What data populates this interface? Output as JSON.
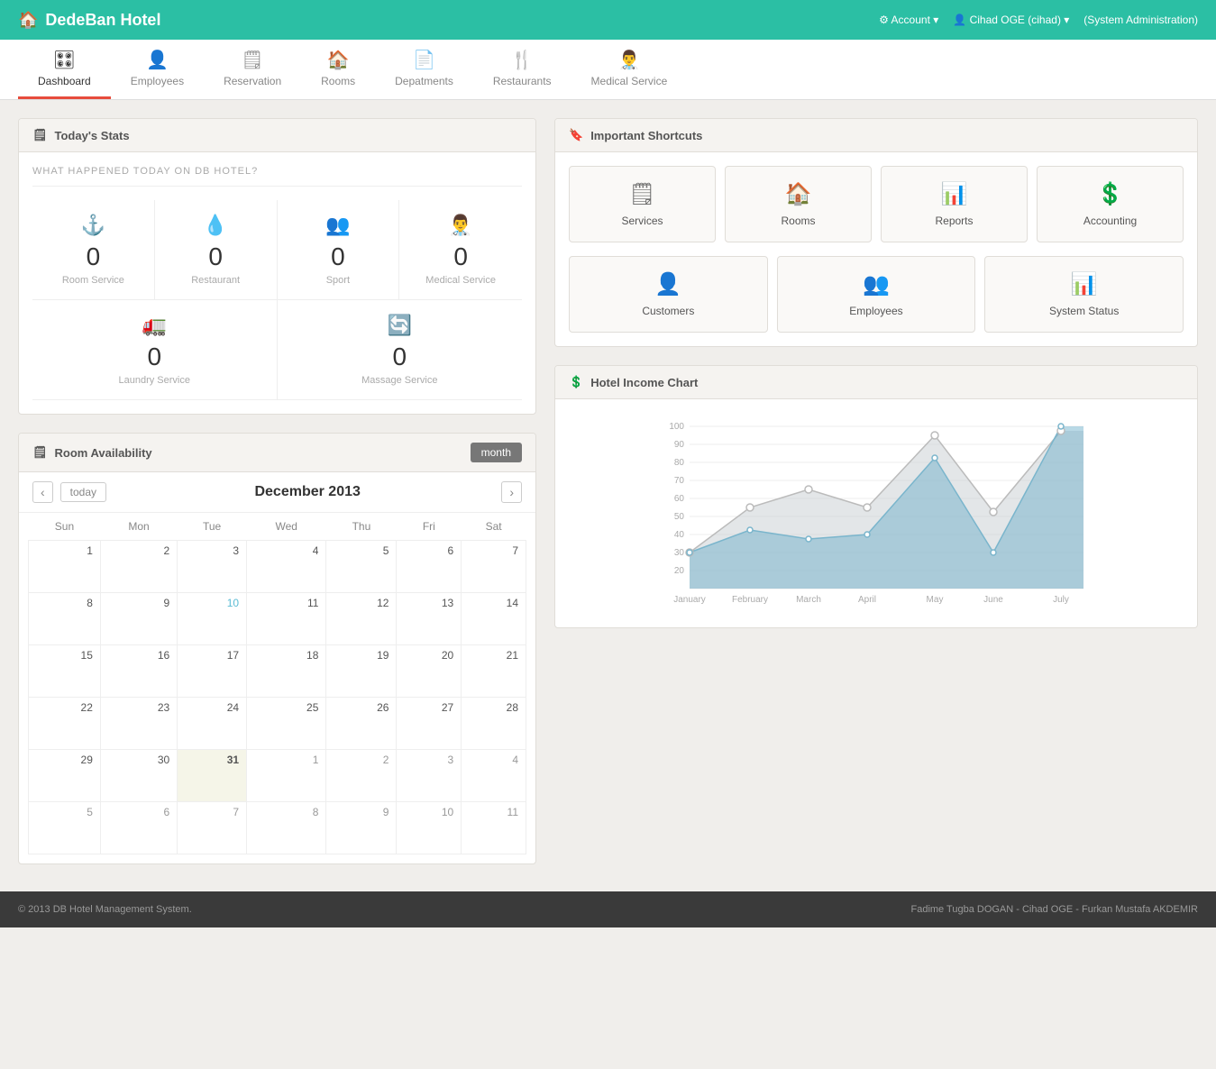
{
  "header": {
    "brand": "DedeBan Hotel",
    "home_icon": "🏠",
    "account_label": "Account",
    "user_label": "Cihad OGE (cihad)",
    "role_label": "(System Administration)"
  },
  "nav": {
    "items": [
      {
        "id": "dashboard",
        "label": "Dashboard",
        "icon": "🎛",
        "active": true
      },
      {
        "id": "employees",
        "label": "Employees",
        "icon": "👤",
        "active": false
      },
      {
        "id": "reservation",
        "label": "Reservation",
        "icon": "🗒",
        "active": false
      },
      {
        "id": "rooms",
        "label": "Rooms",
        "icon": "🏠",
        "active": false
      },
      {
        "id": "departments",
        "label": "Depatments",
        "icon": "📄",
        "active": false
      },
      {
        "id": "restaurants",
        "label": "Restaurants",
        "icon": "🍴",
        "active": false
      },
      {
        "id": "medical",
        "label": "Medical Service",
        "icon": "👨‍⚕️",
        "active": false
      }
    ]
  },
  "stats": {
    "title": "Today's Stats",
    "subtitle": "WHAT HAPPENED TODAY ON DB HOTEL?",
    "items": [
      {
        "id": "room-service",
        "label": "Room Service",
        "value": "0",
        "icon": "⚓"
      },
      {
        "id": "restaurant",
        "label": "Restaurant",
        "value": "0",
        "icon": "💧"
      },
      {
        "id": "sport",
        "label": "Sport",
        "value": "0",
        "icon": "👥"
      },
      {
        "id": "medical",
        "label": "Medical Service",
        "value": "0",
        "icon": "👨‍⚕️"
      },
      {
        "id": "laundry",
        "label": "Laundry Service",
        "value": "0",
        "icon": "🚛"
      },
      {
        "id": "massage",
        "label": "Massage Service",
        "value": "0",
        "icon": "🔄"
      }
    ]
  },
  "shortcuts": {
    "title": "Important Shortcuts",
    "row1": [
      {
        "id": "services",
        "label": "Services",
        "icon": "🗒"
      },
      {
        "id": "rooms",
        "label": "Rooms",
        "icon": "🏠"
      },
      {
        "id": "reports",
        "label": "Reports",
        "icon": "📊"
      },
      {
        "id": "accounting",
        "label": "Accounting",
        "icon": "💲"
      }
    ],
    "row2": [
      {
        "id": "customers",
        "label": "Customers",
        "icon": "👤"
      },
      {
        "id": "employees",
        "label": "Employees",
        "icon": "👥"
      },
      {
        "id": "system-status",
        "label": "System Status",
        "icon": "📊"
      }
    ]
  },
  "calendar": {
    "title": "Room Availability",
    "month_title": "December 2013",
    "view_btn": "month",
    "today_btn": "today",
    "days": [
      "Sun",
      "Mon",
      "Tue",
      "Wed",
      "Thu",
      "Fri",
      "Sat"
    ],
    "weeks": [
      [
        {
          "day": "1",
          "type": "current"
        },
        {
          "day": "2",
          "type": "current"
        },
        {
          "day": "3",
          "type": "current"
        },
        {
          "day": "4",
          "type": "current"
        },
        {
          "day": "5",
          "type": "current"
        },
        {
          "day": "6",
          "type": "current"
        },
        {
          "day": "7",
          "type": "current"
        }
      ],
      [
        {
          "day": "8",
          "type": "current"
        },
        {
          "day": "9",
          "type": "current"
        },
        {
          "day": "10",
          "type": "highlight"
        },
        {
          "day": "11",
          "type": "current"
        },
        {
          "day": "12",
          "type": "current"
        },
        {
          "day": "13",
          "type": "current"
        },
        {
          "day": "14",
          "type": "current"
        }
      ],
      [
        {
          "day": "15",
          "type": "current"
        },
        {
          "day": "16",
          "type": "current"
        },
        {
          "day": "17",
          "type": "current"
        },
        {
          "day": "18",
          "type": "current"
        },
        {
          "day": "19",
          "type": "current"
        },
        {
          "day": "20",
          "type": "current"
        },
        {
          "day": "21",
          "type": "current"
        }
      ],
      [
        {
          "day": "22",
          "type": "current"
        },
        {
          "day": "23",
          "type": "current"
        },
        {
          "day": "24",
          "type": "current"
        },
        {
          "day": "25",
          "type": "current"
        },
        {
          "day": "26",
          "type": "current"
        },
        {
          "day": "27",
          "type": "current"
        },
        {
          "day": "28",
          "type": "current"
        }
      ],
      [
        {
          "day": "29",
          "type": "current"
        },
        {
          "day": "30",
          "type": "current"
        },
        {
          "day": "31",
          "type": "today"
        },
        {
          "day": "1",
          "type": "other"
        },
        {
          "day": "2",
          "type": "other"
        },
        {
          "day": "3",
          "type": "other"
        },
        {
          "day": "4",
          "type": "other"
        }
      ],
      [
        {
          "day": "5",
          "type": "other"
        },
        {
          "day": "6",
          "type": "other"
        },
        {
          "day": "7",
          "type": "other"
        },
        {
          "day": "8",
          "type": "other"
        },
        {
          "day": "9",
          "type": "other"
        },
        {
          "day": "10",
          "type": "other"
        },
        {
          "day": "11",
          "type": "other"
        }
      ]
    ]
  },
  "chart": {
    "title": "Hotel Income Chart",
    "y_labels": [
      "100",
      "90",
      "80",
      "70",
      "60",
      "50",
      "40",
      "30",
      "20"
    ],
    "x_labels": [
      "January",
      "February",
      "March",
      "April",
      "May",
      "June",
      "July"
    ]
  },
  "footer": {
    "left": "© 2013 DB Hotel Management System.",
    "right": "Fadime Tugba DOGAN - Cihad OGE - Furkan Mustafa AKDEMIR"
  }
}
